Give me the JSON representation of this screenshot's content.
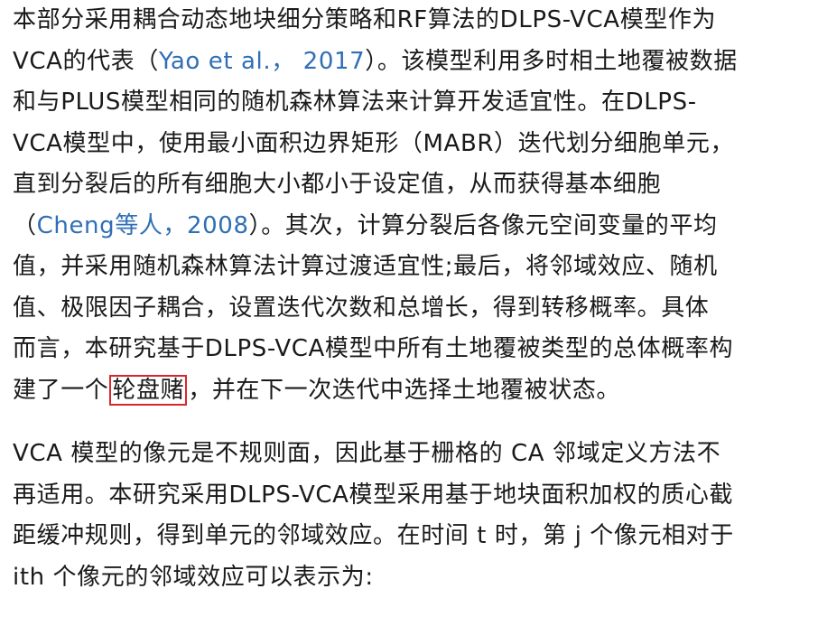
{
  "paragraph1": {
    "line1": "本部分采用耦合动态地块细分策略和RF算法的DLPS-VCA模型作为",
    "line2_a": "VCA的代表（",
    "line2_cite": "Yao et al.， 2017",
    "line2_b": "）。该模型利用多时相土地覆被数据",
    "line3": "和与PLUS模型相同的随机森林算法来计算开发适宜性。在DLPS-",
    "line4": "VCA模型中，使用最小面积边界矩形（MABR）迭代划分细胞单元，",
    "line5": "直到分裂后的所有细胞大小都小于设定值，从而获得基本细胞",
    "line6_a": "（",
    "line6_cite": "Cheng等人，2008",
    "line6_b": "）。其次，计算分裂后各像元空间变量的平均",
    "line7": "值，并采用随机森林算法计算过渡适宜性;最后，将邻域效应、随机",
    "line8": "值、极限因子耦合，设置迭代次数和总增长，得到转移概率。具体",
    "line9": "而言，本研究基于DLPS-VCA模型中所有土地覆被类型的总体概率构",
    "line10_a": "建了一个",
    "line10_highlight": "轮盘赌",
    "line10_b": "，并在下一次迭代中选择土地覆被状态。"
  },
  "paragraph2": {
    "line1": "VCA 模型的像元是不规则面，因此基于栅格的 CA 邻域定义方法不",
    "line2": "再适用。本研究采用DLPS-VCA模型采用基于地块面积加权的质心截",
    "line3": "距缓冲规则，得到单元的邻域效应。在时间 t 时，第 j 个像元相对于",
    "line4": "ith 个像元的邻域效应可以表示为:"
  },
  "colors": {
    "text": "#1a1a1a",
    "citation_link": "#2f6fb5",
    "highlight_border": "#d9262c"
  }
}
